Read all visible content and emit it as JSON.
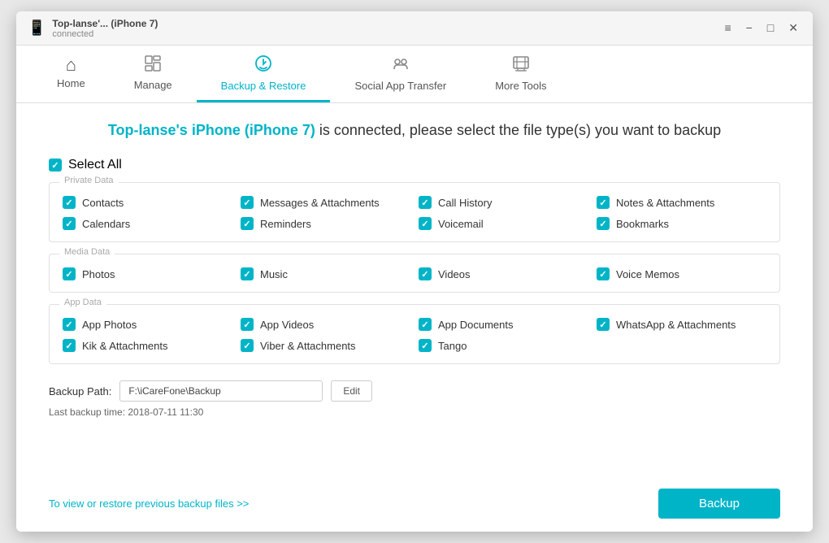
{
  "window": {
    "device_name": "Top-lanse'... (iPhone 7)",
    "device_status": "connected",
    "controls": [
      "≡",
      "−",
      "□",
      "✕"
    ]
  },
  "navbar": {
    "items": [
      {
        "id": "home",
        "label": "Home",
        "icon": "⌂",
        "active": false
      },
      {
        "id": "manage",
        "label": "Manage",
        "icon": "🗂",
        "active": false
      },
      {
        "id": "backup-restore",
        "label": "Backup & Restore",
        "icon": "↩",
        "active": true
      },
      {
        "id": "social-app-transfer",
        "label": "Social App Transfer",
        "icon": "💬",
        "active": false
      },
      {
        "id": "more-tools",
        "label": "More Tools",
        "icon": "🧰",
        "active": false
      }
    ]
  },
  "page": {
    "title_device": "Top-lanse's iPhone (iPhone 7)",
    "title_rest": " is connected, please select the file type(s) you want to backup",
    "select_all_label": "Select All"
  },
  "sections": {
    "private": {
      "label": "Private Data",
      "items": [
        "Contacts",
        "Messages & Attachments",
        "Call History",
        "Notes & Attachments",
        "Calendars",
        "Reminders",
        "Voicemail",
        "Bookmarks"
      ]
    },
    "media": {
      "label": "Media Data",
      "items": [
        "Photos",
        "Music",
        "Videos",
        "Voice Memos"
      ]
    },
    "app": {
      "label": "App Data",
      "items": [
        "App Photos",
        "App Videos",
        "App Documents",
        "WhatsApp & Attachments",
        "Kik & Attachments",
        "Viber & Attachments",
        "Tango",
        ""
      ]
    }
  },
  "backup_path": {
    "label": "Backup Path:",
    "value": "F:\\iCareFone\\Backup",
    "edit_label": "Edit"
  },
  "last_backup": "Last backup time: 2018-07-11 11:30",
  "restore_link": "To view or restore previous backup files >>",
  "backup_button": "Backup"
}
